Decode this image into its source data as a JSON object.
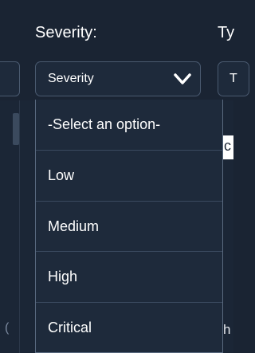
{
  "form": {
    "severity_label": "Severity:",
    "type_label": "Ty",
    "severity_select_value": "Severity",
    "type_select_value": "T"
  },
  "dropdown": {
    "options": [
      "-Select an option-",
      "Low",
      "Medium",
      "High",
      "Critical"
    ]
  },
  "background": {
    "right_card_text": "c",
    "right_bottom_text": "h",
    "left_bottom_text": "("
  },
  "icons": {
    "chevron": "chevron-down-icon"
  },
  "colors": {
    "page_bg": "#1a2433",
    "control_bg": "#1e2a3b",
    "border": "#4a5a70",
    "text": "#ffffff"
  }
}
